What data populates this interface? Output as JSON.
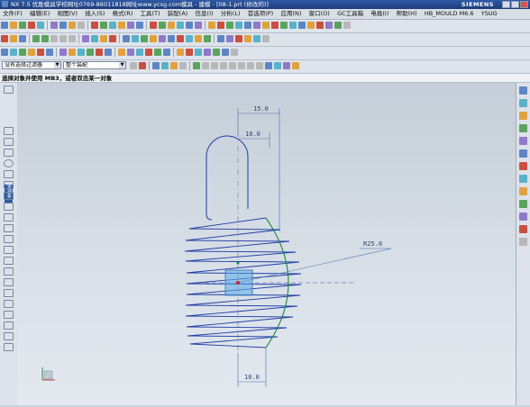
{
  "titlebar": {
    "title": "NX 7.5 优胜模具学校网址0769-86011818网址www.ycsg.com模具 - 建模 - [08-1.prt (修改的)]",
    "brand": "SIEMENS"
  },
  "menu": [
    "文件(F)",
    "编辑(E)",
    "视图(V)",
    "插入(S)",
    "格式(R)",
    "工具(T)",
    "装配(A)",
    "信息(I)",
    "分析(L)",
    "首选项(P)",
    "应用(N)",
    "窗口(O)",
    "GC工具箱",
    "电极(I)",
    "帮助(H)",
    "HB_MOULD M6.6",
    "YSUG"
  ],
  "selection_bar": {
    "filter_value": "没有选择过滤器",
    "scope_value": "整个装配"
  },
  "cue_line": "选择对象并使用 MB3，或者双击某一对象",
  "left_toolbar": {
    "tab_label": "资源条"
  },
  "drawing": {
    "dim_top_outer": "15.0",
    "dim_top_inner": "10.0",
    "dim_radius": "R25.0",
    "dim_bottom": "10.0"
  },
  "colors": {
    "sketch_curve": "#1f3fa6",
    "arc_green": "#1c8a3a",
    "dimension": "#4a6ea8",
    "center_line": "#7a86a8"
  }
}
